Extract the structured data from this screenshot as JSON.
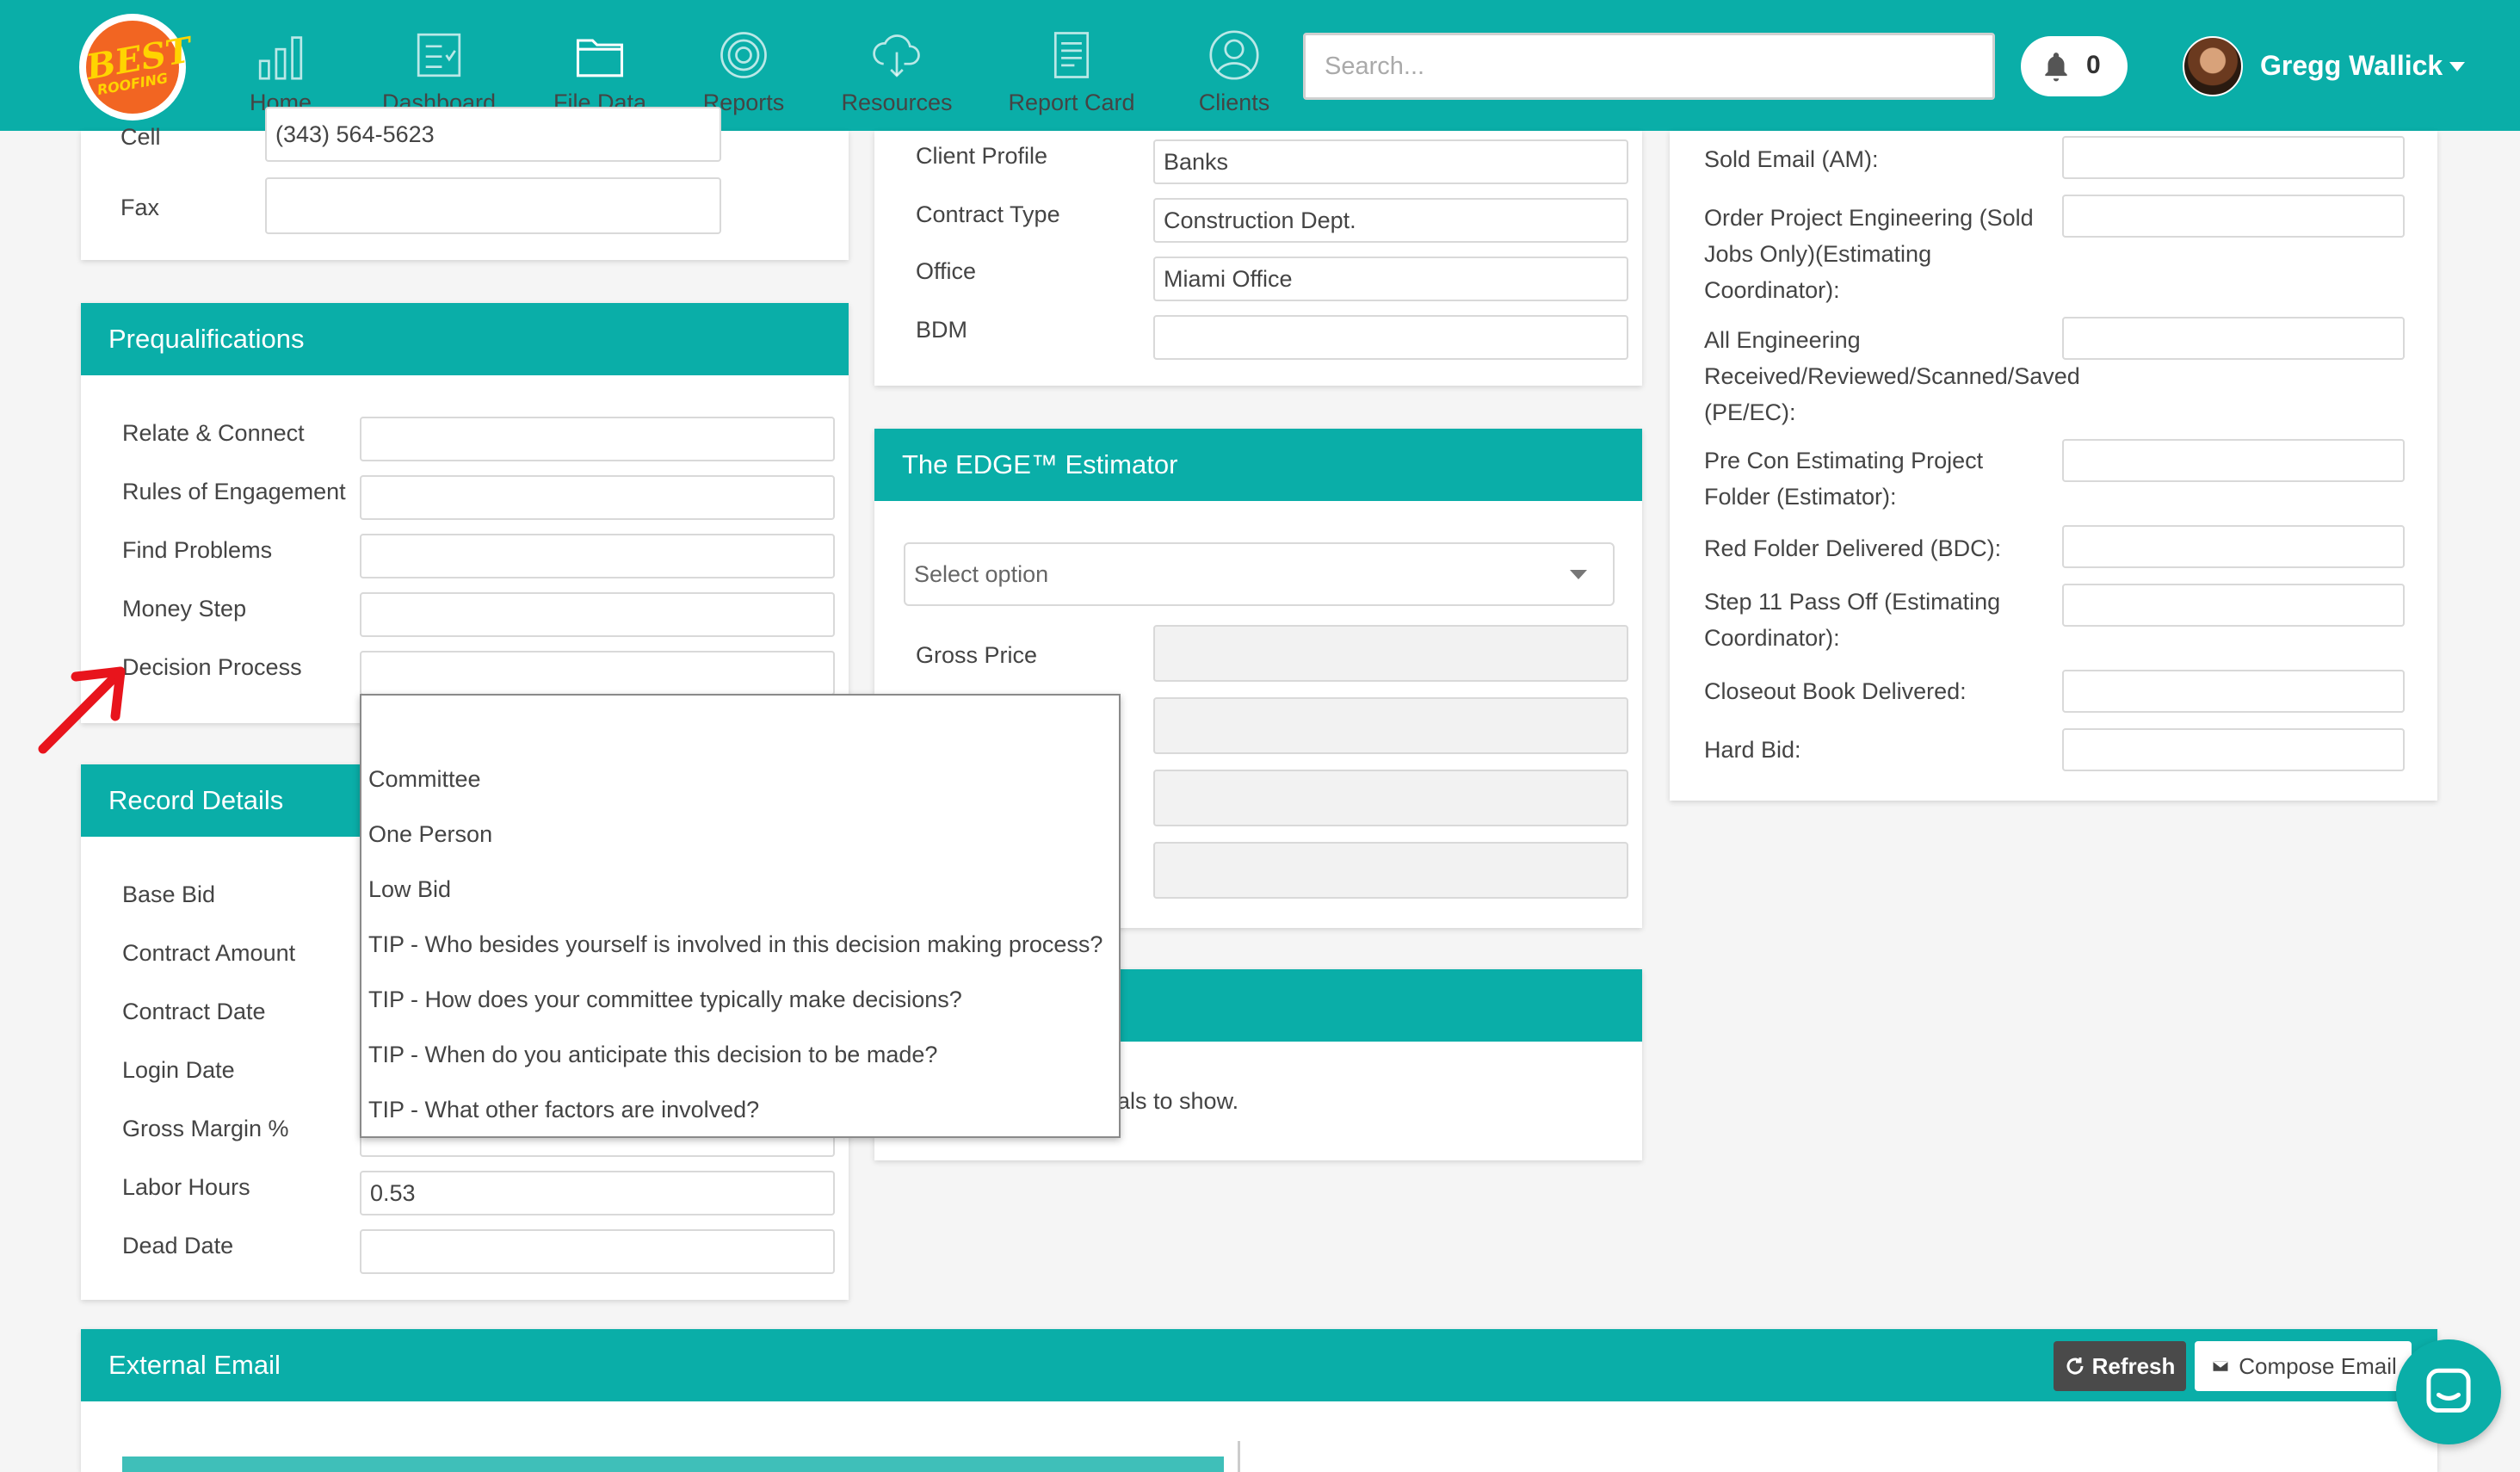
{
  "nav": {
    "logo": {
      "line1": "BEST",
      "line2": "ROOFING"
    },
    "items": [
      {
        "label": "Home",
        "icon": "bar-chart-icon",
        "active": false
      },
      {
        "label": "Dashboard",
        "icon": "checklist-icon",
        "active": false
      },
      {
        "label": "File Data",
        "icon": "folder-icon",
        "active": true
      },
      {
        "label": "Reports",
        "icon": "target-icon",
        "active": false
      },
      {
        "label": "Resources",
        "icon": "cloud-download-icon",
        "active": false
      },
      {
        "label": "Report Card",
        "icon": "document-icon",
        "active": false
      },
      {
        "label": "Clients",
        "icon": "user-icon",
        "active": false
      }
    ],
    "search_placeholder": "Search...",
    "notification_count": "0",
    "user_name": "Gregg Wallick"
  },
  "contact": {
    "cell_label": "Cell",
    "cell_value": "(343) 564-5623",
    "fax_label": "Fax",
    "fax_value": ""
  },
  "prequal": {
    "title": "Prequalifications",
    "fields": [
      {
        "label": "Relate & Connect",
        "value": ""
      },
      {
        "label": "Rules of Engagement",
        "value": ""
      },
      {
        "label": "Find Problems",
        "value": ""
      },
      {
        "label": "Money Step",
        "value": ""
      },
      {
        "label": "Decision Process",
        "value": ""
      }
    ]
  },
  "decision_dropdown": {
    "options": [
      "",
      "Committee",
      "One Person",
      "Low Bid",
      "TIP - Who besides yourself is involved in this decision making process?",
      "TIP - How does your committee typically make decisions?",
      "TIP - When do you anticipate this decision to be made?",
      "TIP - What other factors are involved?"
    ]
  },
  "record": {
    "title": "Record Details",
    "fields": [
      {
        "label": "Base Bid",
        "value": ""
      },
      {
        "label": "Contract Amount",
        "value": ""
      },
      {
        "label": "Contract Date",
        "value": ""
      },
      {
        "label": "Login Date",
        "value": ""
      },
      {
        "label": "Gross Margin %",
        "value": ""
      },
      {
        "label": "Labor Hours",
        "value": "0.53"
      },
      {
        "label": "Dead Date",
        "value": ""
      }
    ]
  },
  "client": {
    "fields": [
      {
        "label": "Client Profile",
        "value": "Banks"
      },
      {
        "label": "Contract Type",
        "value": "Construction Dept."
      },
      {
        "label": "Office",
        "value": "Miami Office"
      },
      {
        "label": "BDM",
        "value": ""
      }
    ]
  },
  "edge": {
    "title": "The EDGE™ Estimator",
    "select_placeholder": "Select option",
    "gross_price_label": "Gross Price",
    "gross_price_value": ""
  },
  "third_card": {
    "empty_text_fragment": "als to show."
  },
  "milestones": {
    "fields": [
      {
        "label": "Sold Email (AM):",
        "value": ""
      },
      {
        "label": "Order Project Engineering (Sold Jobs Only)(Estimating Coordinator):",
        "lines": [
          "Order Project Engineering (Sold",
          "Jobs Only)(Estimating",
          "Coordinator):"
        ],
        "value": ""
      },
      {
        "label": "All Engineering Received/Reviewed/Scanned/Saved (PE/EC):",
        "lines": [
          "All Engineering",
          "Received/Reviewed/Scanned/Saved",
          "(PE/EC):"
        ],
        "value": ""
      },
      {
        "label": "Pre Con Estimating Project Folder (Estimator):",
        "lines": [
          "Pre Con Estimating Project",
          "Folder (Estimator):"
        ],
        "value": ""
      },
      {
        "label": "Red Folder Delivered (BDC):",
        "value": ""
      },
      {
        "label": "Step 11 Pass Off (Estimating Coordinator):",
        "lines": [
          "Step 11 Pass Off (Estimating",
          "Coordinator):"
        ],
        "value": ""
      },
      {
        "label": "Closeout Book Delivered:",
        "value": ""
      },
      {
        "label": "Hard Bid:",
        "value": ""
      }
    ]
  },
  "external_email": {
    "title": "External Email",
    "refresh_label": "Refresh",
    "compose_label": "Compose Email"
  },
  "colors": {
    "brand": "#0aaea8",
    "annotation_arrow": "#e8141c",
    "logo_orange": "#f26522",
    "logo_yellow": "#ffd400"
  }
}
